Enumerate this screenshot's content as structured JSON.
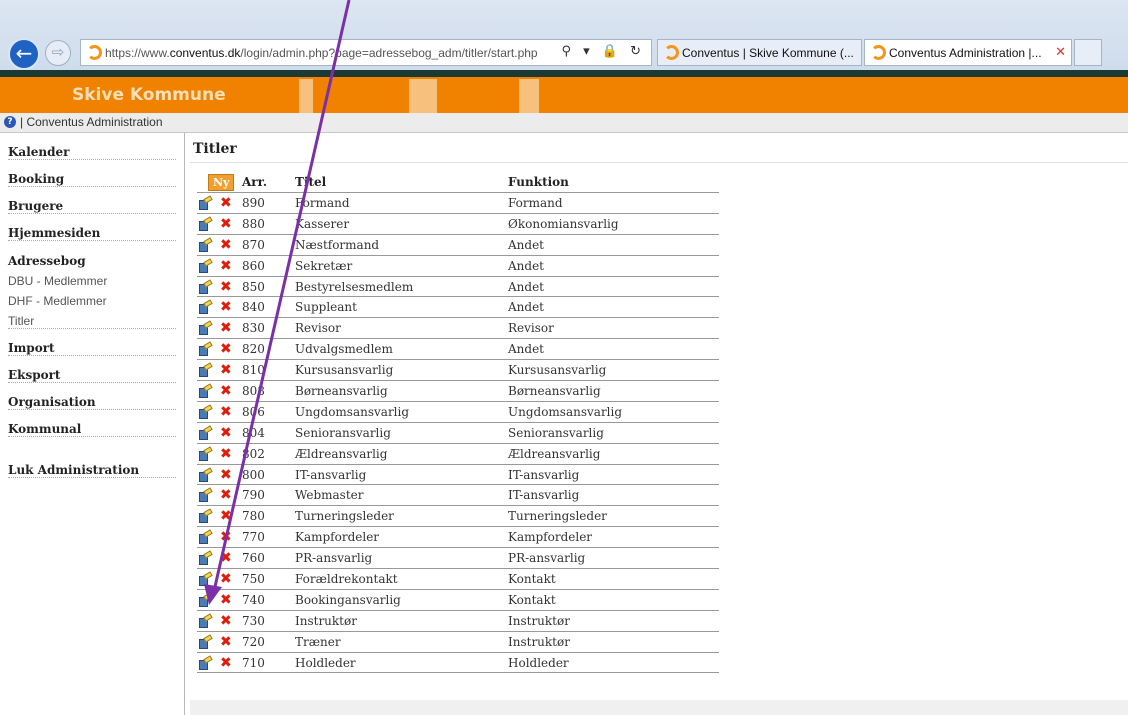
{
  "browser": {
    "url_prefix": "https://www.",
    "url_domain": "conventus.dk",
    "url_path": "/login/admin.php?page=adressebog_adm/titler/start.php",
    "address_icons": "⚲ ▾ 🔒 ↻",
    "tabs": [
      {
        "label": "Conventus | Skive Kommune (..."
      },
      {
        "label": "Conventus Administration |..."
      }
    ]
  },
  "header": {
    "brand": "Skive Kommune",
    "breadcrumb": "| Conventus Administration"
  },
  "sidebar": {
    "items": [
      {
        "label": "Kalender",
        "type": "bold"
      },
      {
        "label": "Booking",
        "type": "bold"
      },
      {
        "label": "Brugere",
        "type": "bold"
      },
      {
        "label": "Hjemmesiden",
        "type": "bold"
      },
      {
        "label": "Adressebog",
        "type": "bold"
      },
      {
        "label": "DBU - Medlemmer",
        "type": "plain"
      },
      {
        "label": "DHF - Medlemmer",
        "type": "plain"
      },
      {
        "label": "Titler",
        "type": "plain"
      },
      {
        "label": "Import",
        "type": "bold"
      },
      {
        "label": "Eksport",
        "type": "bold"
      },
      {
        "label": "Organisation",
        "type": "bold"
      },
      {
        "label": "Kommunal",
        "type": "bold"
      },
      {
        "label": "Luk Administration",
        "type": "bold"
      }
    ]
  },
  "main": {
    "title": "Titler",
    "new_button": "Ny",
    "columns": [
      "Arr.",
      "Titel",
      "Funktion"
    ],
    "rows": [
      {
        "arr": "890",
        "titel": "Formand",
        "funktion": "Formand"
      },
      {
        "arr": "880",
        "titel": "Kasserer",
        "funktion": "Økonomiansvarlig"
      },
      {
        "arr": "870",
        "titel": "Næstformand",
        "funktion": "Andet"
      },
      {
        "arr": "860",
        "titel": "Sekretær",
        "funktion": "Andet"
      },
      {
        "arr": "850",
        "titel": "Bestyrelsesmedlem",
        "funktion": "Andet"
      },
      {
        "arr": "840",
        "titel": "Suppleant",
        "funktion": "Andet"
      },
      {
        "arr": "830",
        "titel": "Revisor",
        "funktion": "Revisor"
      },
      {
        "arr": "820",
        "titel": "Udvalgsmedlem",
        "funktion": "Andet"
      },
      {
        "arr": "810",
        "titel": "Kursusansvarlig",
        "funktion": "Kursusansvarlig"
      },
      {
        "arr": "808",
        "titel": "Børneansvarlig",
        "funktion": "Børneansvarlig"
      },
      {
        "arr": "806",
        "titel": "Ungdomsansvarlig",
        "funktion": "Ungdomsansvarlig"
      },
      {
        "arr": "804",
        "titel": "Senioransvarlig",
        "funktion": "Senioransvarlig"
      },
      {
        "arr": "802",
        "titel": "Ældreansvarlig",
        "funktion": "Ældreansvarlig"
      },
      {
        "arr": "800",
        "titel": "IT-ansvarlig",
        "funktion": "IT-ansvarlig"
      },
      {
        "arr": "790",
        "titel": "Webmaster",
        "funktion": "IT-ansvarlig"
      },
      {
        "arr": "780",
        "titel": "Turneringsleder",
        "funktion": "Turneringsleder"
      },
      {
        "arr": "770",
        "titel": "Kampfordeler",
        "funktion": "Kampfordeler"
      },
      {
        "arr": "760",
        "titel": "PR-ansvarlig",
        "funktion": "PR-ansvarlig"
      },
      {
        "arr": "750",
        "titel": "Forældrekontakt",
        "funktion": "Kontakt"
      },
      {
        "arr": "740",
        "titel": "Bookingansvarlig",
        "funktion": "Kontakt"
      },
      {
        "arr": "730",
        "titel": "Instruktør",
        "funktion": "Instruktør"
      },
      {
        "arr": "720",
        "titel": "Træner",
        "funktion": "Instruktør"
      },
      {
        "arr": "710",
        "titel": "Holdleder",
        "funktion": "Holdleder"
      }
    ]
  },
  "icons": {
    "back": "back-arrow-icon",
    "forward": "forward-arrow-icon",
    "edit": "edit-icon",
    "delete": "delete-icon",
    "help": "help-icon"
  },
  "colors": {
    "header_orange": "#f08200",
    "annotation_arrow": "#7b2fa8",
    "delete_red": "#e01d0b"
  }
}
